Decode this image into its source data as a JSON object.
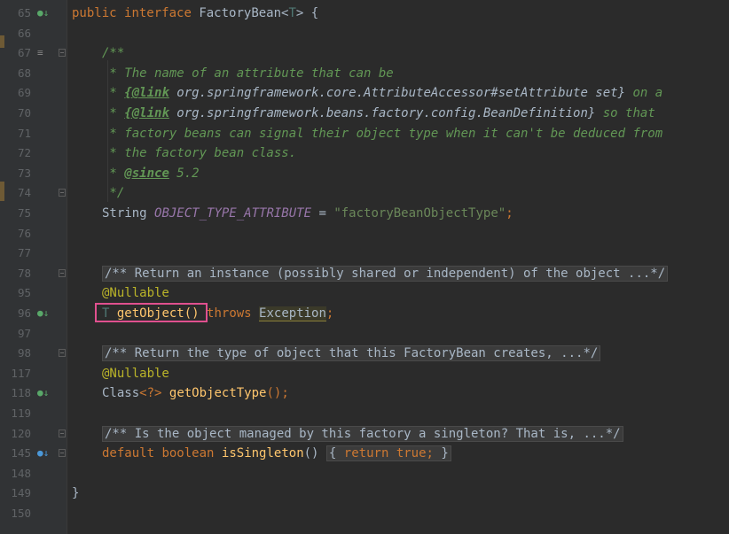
{
  "editor": {
    "line_numbers": [
      "65",
      "66",
      "67",
      "68",
      "69",
      "70",
      "71",
      "72",
      "73",
      "74",
      "75",
      "76",
      "77",
      "78",
      "95",
      "96",
      "97",
      "98",
      "117",
      "118",
      "119",
      "120",
      "145",
      "148",
      "149",
      "150"
    ],
    "line1": {
      "kw_public": "public",
      "kw_interface": "interface",
      "name": "FactoryBean",
      "lt": "<",
      "type": "T",
      "gt": ">",
      "brace": " {"
    },
    "doc": {
      "open": "/**",
      "l1": " * The name of an attribute that can be",
      "l2_star": " * ",
      "l2_tag": "{@link",
      "l2_ref": " org.springframework.core.AttributeAccessor#setAttribute set}",
      "l2_tail": " on a",
      "l3_star": " * ",
      "l3_tag": "{@link",
      "l3_ref": " org.springframework.beans.factory.config.BeanDefinition}",
      "l3_tail": " so that",
      "l4": " * factory beans can signal their object type when it can't be deduced from",
      "l5": " * the factory bean class.",
      "l6_star": " * ",
      "l6_tag": "@since",
      "l6_tail": " 5.2",
      "close": " */"
    },
    "field_line": {
      "type": "String",
      "name": "OBJECT_TYPE_ATTRIBUTE",
      "eq": " = ",
      "value": "\"factoryBeanObjectType\"",
      "semi": ";"
    },
    "getobject_doc": "/** Return an instance (possibly shared or independent) of the object ...*/",
    "nullable1": "@Nullable",
    "getobject_line": {
      "type": "T",
      "name": "getObject",
      "parens": "()",
      "throws": "throws",
      "exception": "Exception",
      "semi": ";"
    },
    "gettype_doc": "/** Return the type of object that this FactoryBean creates, ...*/",
    "nullable2": "@Nullable",
    "gettype_line": {
      "type": "Class",
      "generic": "<?>",
      "name": "getObjectType",
      "tail": "();"
    },
    "singleton_doc": "/** Is the object managed by this factory a singleton? That is, ...*/",
    "singleton_line": {
      "kw_default": "default",
      "kw_boolean": "boolean",
      "name": "isSingleton",
      "parens": "()",
      "body_open": "{",
      "kw_return": "return",
      "kw_true": "true",
      "semi": ";",
      "body_close": "}"
    },
    "close_brace": "}"
  },
  "gutter_icons": {
    "implemented_icon": "●↓",
    "override_icon": "●↓",
    "doc_icon": "≡"
  },
  "colors": {
    "background": "#2b2b2b",
    "keyword": "#cc7832",
    "comment": "#629755",
    "string": "#6a8759",
    "annotation": "#bbb529",
    "method": "#ffc66d",
    "field": "#9876aa",
    "highlight_box": "#e0508f"
  }
}
